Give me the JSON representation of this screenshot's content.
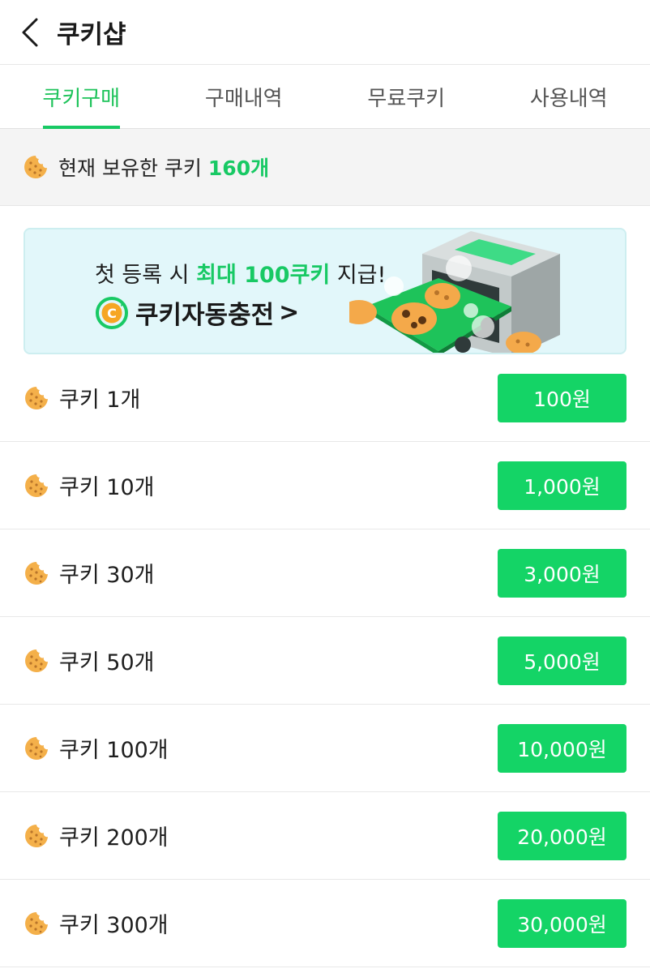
{
  "header": {
    "title": "쿠키샵",
    "back_icon": "chevron-left-icon"
  },
  "tabs": [
    {
      "label": "쿠키구매",
      "active": true
    },
    {
      "label": "구매내역",
      "active": false
    },
    {
      "label": "무료쿠키",
      "active": false
    },
    {
      "label": "사용내역",
      "active": false
    }
  ],
  "balance": {
    "text": "현재 보유한 쿠키",
    "count": "160개"
  },
  "banner": {
    "line1_prefix": "첫 등록 시",
    "line1_highlight": "최대 100쿠키",
    "line1_suffix": "지급!",
    "line2_label": "쿠키자동충전",
    "line2_arrow": ">"
  },
  "items": [
    {
      "name": "쿠키 1개",
      "price": "100원"
    },
    {
      "name": "쿠키 10개",
      "price": "1,000원"
    },
    {
      "name": "쿠키 30개",
      "price": "3,000원"
    },
    {
      "name": "쿠키 50개",
      "price": "5,000원"
    },
    {
      "name": "쿠키 100개",
      "price": "10,000원"
    },
    {
      "name": "쿠키 200개",
      "price": "20,000원"
    },
    {
      "name": "쿠키 300개",
      "price": "30,000원"
    }
  ],
  "colors": {
    "accent": "#18c964",
    "button": "#14d466",
    "cookie": "#f4b04a"
  }
}
